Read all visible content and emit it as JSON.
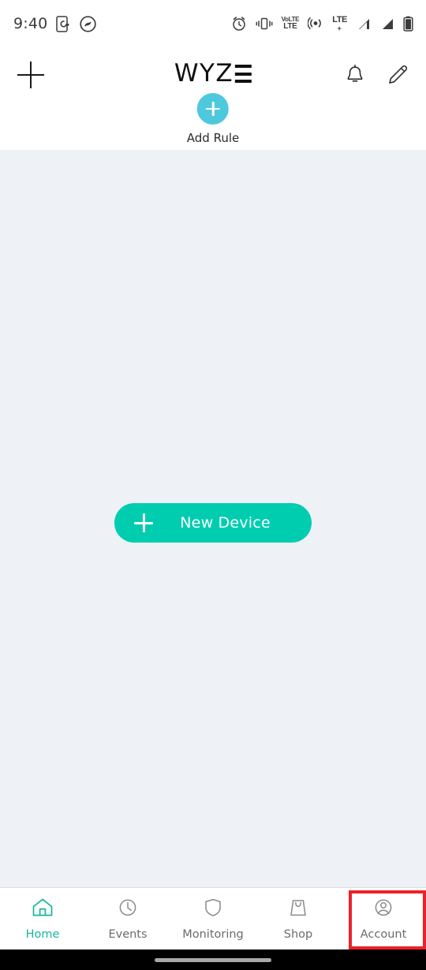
{
  "status_bar": {
    "time": "9:40",
    "left_icons": [
      "screenshot-icon",
      "shazam-icon"
    ],
    "right_icons": [
      "alarm-icon",
      "vibrate-icon",
      "volte-icon",
      "hotspot-icon",
      "lte-plus-icon",
      "signal-1-icon",
      "signal-2-icon",
      "battery-icon"
    ],
    "volte_top": "VoLTE",
    "volte_line1": "VoLTE",
    "volte_line2": "LTE",
    "lte_line1": "LTE",
    "lte_line2": "+"
  },
  "header": {
    "add_button_label": "+",
    "logo_text": "WYZ",
    "logo_suffix": "E",
    "notification_icon": "bell-icon",
    "edit_icon": "pencil-icon",
    "add_rule_label": "Add Rule"
  },
  "main": {
    "new_device_label": "New Device"
  },
  "bottom_nav": {
    "items": [
      {
        "label": "Home",
        "icon": "home-icon",
        "active": true
      },
      {
        "label": "Events",
        "icon": "clock-icon",
        "active": false
      },
      {
        "label": "Monitoring",
        "icon": "shield-icon",
        "active": false
      },
      {
        "label": "Shop",
        "icon": "shopping-bag-icon",
        "active": false
      },
      {
        "label": "Account",
        "icon": "person-circle-icon",
        "active": false
      }
    ]
  },
  "annotation": {
    "highlight_color": "#ec2227",
    "highlight_target": "Account"
  },
  "colors": {
    "accent_teal": "#00cdb0",
    "accent_cyan": "#4ec8dd",
    "active_nav": "#17b69c",
    "content_bg": "#eef1f6"
  }
}
